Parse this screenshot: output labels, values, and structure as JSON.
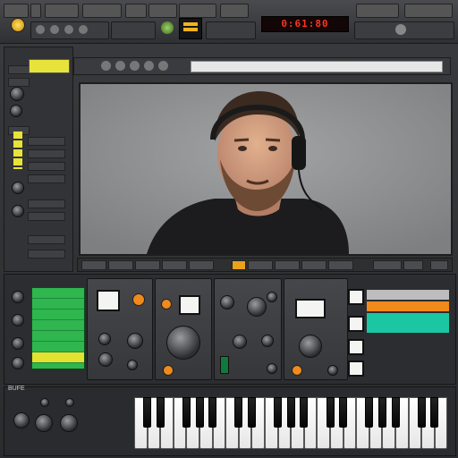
{
  "app": {
    "lcd_readout": "0:61:80",
    "model_label": "BUFE",
    "accent_colors": {
      "yellow": "#e8e33a",
      "green": "#2fb64e",
      "orange": "#f08a1c",
      "teal": "#1bc7a3",
      "red_lcd": "#ff3322"
    }
  },
  "toolbar": {
    "icons": [
      "app-logo-icon",
      "folder-icon",
      "save-icon",
      "undo-icon",
      "redo-icon",
      "mixer-icon",
      "settings-icon"
    ]
  },
  "video": {
    "subject": "man-with-headphones"
  },
  "rack": {
    "modules": 4,
    "color_bars": [
      "#bdbdbd",
      "#f08a1c",
      "#1bc7a3",
      "#1bc7a3"
    ]
  },
  "keyboard": {
    "white_keys": 24
  }
}
